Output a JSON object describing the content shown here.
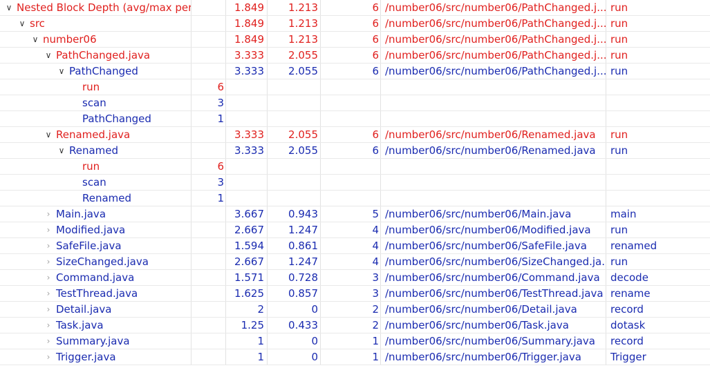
{
  "colors": {
    "violation": "#e0201e",
    "normal": "#1a2bb0"
  },
  "icons": {
    "expanded": "chevron-down-icon",
    "collapsed": "chevron-right-icon"
  },
  "rows": [
    {
      "depth": 0,
      "twisty": "expanded",
      "color": "red",
      "name": "Nested Block Depth (avg/max per r",
      "v1": "1.849",
      "v2": "1.213",
      "v3": "6",
      "path": "/number06/src/number06/PathChanged.j...",
      "method": "run"
    },
    {
      "depth": 1,
      "twisty": "expanded",
      "color": "red",
      "name": "src",
      "v1": "1.849",
      "v2": "1.213",
      "v3": "6",
      "path": "/number06/src/number06/PathChanged.j...",
      "method": "run"
    },
    {
      "depth": 2,
      "twisty": "expanded",
      "color": "red",
      "name": "number06",
      "v1": "1.849",
      "v2": "1.213",
      "v3": "6",
      "path": "/number06/src/number06/PathChanged.j...",
      "method": "run"
    },
    {
      "depth": 3,
      "twisty": "expanded",
      "color": "red",
      "name": "PathChanged.java",
      "v1": "3.333",
      "v2": "2.055",
      "v3": "6",
      "path": "/number06/src/number06/PathChanged.j...",
      "method": "run"
    },
    {
      "depth": 4,
      "twisty": "expanded",
      "color": "blue",
      "name": "PathChanged",
      "v1": "3.333",
      "v2": "2.055",
      "v3": "6",
      "path": "/number06/src/number06/PathChanged.j...",
      "method": "run"
    },
    {
      "depth": 5,
      "twisty": "none",
      "color": "red",
      "name": "run",
      "v0": "6"
    },
    {
      "depth": 5,
      "twisty": "none",
      "color": "blue",
      "name": "scan",
      "v0": "3"
    },
    {
      "depth": 5,
      "twisty": "none",
      "color": "blue",
      "name": "PathChanged",
      "v0": "1"
    },
    {
      "depth": 3,
      "twisty": "expanded",
      "color": "red",
      "name": "Renamed.java",
      "v1": "3.333",
      "v2": "2.055",
      "v3": "6",
      "path": "/number06/src/number06/Renamed.java",
      "method": "run"
    },
    {
      "depth": 4,
      "twisty": "expanded",
      "color": "blue",
      "name": "Renamed",
      "v1": "3.333",
      "v2": "2.055",
      "v3": "6",
      "path": "/number06/src/number06/Renamed.java",
      "method": "run"
    },
    {
      "depth": 5,
      "twisty": "none",
      "color": "red",
      "name": "run",
      "v0": "6"
    },
    {
      "depth": 5,
      "twisty": "none",
      "color": "blue",
      "name": "scan",
      "v0": "3"
    },
    {
      "depth": 5,
      "twisty": "none",
      "color": "blue",
      "name": "Renamed",
      "v0": "1"
    },
    {
      "depth": 3,
      "twisty": "collapsed",
      "color": "blue",
      "name": "Main.java",
      "v1": "3.667",
      "v2": "0.943",
      "v3": "5",
      "path": "/number06/src/number06/Main.java",
      "method": "main"
    },
    {
      "depth": 3,
      "twisty": "collapsed",
      "color": "blue",
      "name": "Modified.java",
      "v1": "2.667",
      "v2": "1.247",
      "v3": "4",
      "path": "/number06/src/number06/Modified.java",
      "method": "run"
    },
    {
      "depth": 3,
      "twisty": "collapsed",
      "color": "blue",
      "name": "SafeFile.java",
      "v1": "1.594",
      "v2": "0.861",
      "v3": "4",
      "path": "/number06/src/number06/SafeFile.java",
      "method": "renamed"
    },
    {
      "depth": 3,
      "twisty": "collapsed",
      "color": "blue",
      "name": "SizeChanged.java",
      "v1": "2.667",
      "v2": "1.247",
      "v3": "4",
      "path": "/number06/src/number06/SizeChanged.ja...",
      "method": "run"
    },
    {
      "depth": 3,
      "twisty": "collapsed",
      "color": "blue",
      "name": "Command.java",
      "v1": "1.571",
      "v2": "0.728",
      "v3": "3",
      "path": "/number06/src/number06/Command.java",
      "method": "decode"
    },
    {
      "depth": 3,
      "twisty": "collapsed",
      "color": "blue",
      "name": "TestThread.java",
      "v1": "1.625",
      "v2": "0.857",
      "v3": "3",
      "path": "/number06/src/number06/TestThread.java",
      "method": "rename"
    },
    {
      "depth": 3,
      "twisty": "collapsed",
      "color": "blue",
      "name": "Detail.java",
      "v1": "2",
      "v2": "0",
      "v3": "2",
      "path": "/number06/src/number06/Detail.java",
      "method": "record"
    },
    {
      "depth": 3,
      "twisty": "collapsed",
      "color": "blue",
      "name": "Task.java",
      "v1": "1.25",
      "v2": "0.433",
      "v3": "2",
      "path": "/number06/src/number06/Task.java",
      "method": "dotask"
    },
    {
      "depth": 3,
      "twisty": "collapsed",
      "color": "blue",
      "name": "Summary.java",
      "v1": "1",
      "v2": "0",
      "v3": "1",
      "path": "/number06/src/number06/Summary.java",
      "method": "record"
    },
    {
      "depth": 3,
      "twisty": "collapsed",
      "color": "blue",
      "name": "Trigger.java",
      "v1": "1",
      "v2": "0",
      "v3": "1",
      "path": "/number06/src/number06/Trigger.java",
      "method": "Trigger"
    }
  ]
}
